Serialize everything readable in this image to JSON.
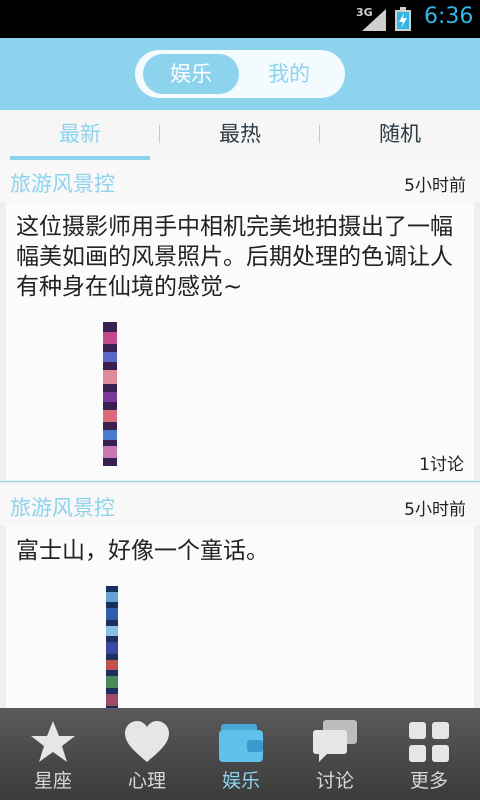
{
  "status_bar": {
    "network": "3G",
    "time": "6:36"
  },
  "header": {
    "segments": [
      {
        "label": "娱乐",
        "active": true
      },
      {
        "label": "我的",
        "active": false
      }
    ]
  },
  "tabs": [
    {
      "label": "最新"
    },
    {
      "label": "最热"
    },
    {
      "label": "随机"
    }
  ],
  "posts": [
    {
      "source": "旅游风景控",
      "time": "5小时前",
      "text": "这位摄影师用手中相机完美地拍摄出了一幅幅美如画的风景照片。后期处理的色调让人有种身在仙境的感觉~",
      "comments": "1讨论"
    },
    {
      "source": "旅游风景控",
      "time": "5小时前",
      "text": "富士山，好像一个童话。"
    }
  ],
  "bottom_nav": [
    {
      "label": "星座",
      "icon": "star-icon"
    },
    {
      "label": "心理",
      "icon": "heart-icon"
    },
    {
      "label": "娱乐",
      "icon": "wallet-icon",
      "active": true
    },
    {
      "label": "讨论",
      "icon": "chat-icon"
    },
    {
      "label": "更多",
      "icon": "grid-icon"
    }
  ],
  "colors": {
    "accent": "#8dd3ee",
    "status_bar": "#000000",
    "nav_bg": "#4a4a4a"
  }
}
